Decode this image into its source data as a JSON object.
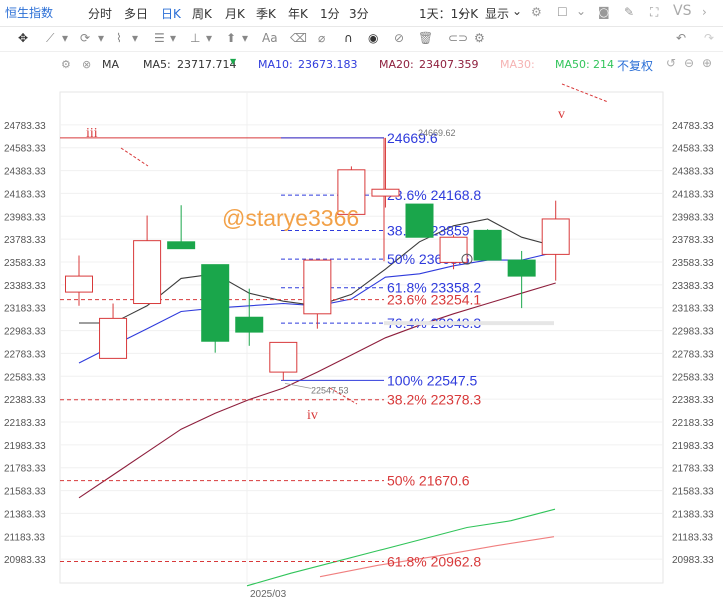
{
  "toolbar": {
    "index_name": "恒生指数",
    "periods": [
      "分时",
      "多日",
      "日K",
      "周K",
      "月K",
      "季K",
      "年K",
      "1分",
      "3分"
    ],
    "active_period": "日K",
    "multi_select": "1天：1分K",
    "display": "显示",
    "vs_label": "VS"
  },
  "ma_bar": {
    "type": "MA",
    "ma5_label": "MA5:",
    "ma5_value": "23717.714",
    "ma10_label": "MA10:",
    "ma10_value": "23673.183",
    "ma20_label": "MA20:",
    "ma20_value": "23407.359",
    "ma30_label": "MA30:",
    "ma50_label": "MA50:",
    "ma50_value": "214",
    "adjust": "不复权"
  },
  "colors": {
    "up": "#d8393a",
    "down": "#1aa64b",
    "ma5": "#3c3c3c",
    "ma10": "#2f3bdc",
    "ma20": "#8e1f3d",
    "ma30": "#f07f7f",
    "ma50": "#31c45a",
    "fib_blue": "#2f3bdc",
    "fib_red": "#d8393a",
    "watermark": "#f2a148"
  },
  "chart_data": {
    "type": "candlestick",
    "x_label_shown": "2025/03",
    "ylim": [
      20783.33,
      24983.33
    ],
    "y_ticks": [
      "24783.33",
      "24583.33",
      "24383.33",
      "24183.33",
      "23983.33",
      "23783.33",
      "23583.33",
      "23383.33",
      "23183.33",
      "22983.33",
      "22783.33",
      "22583.33",
      "22383.33",
      "22183.33",
      "21983.33",
      "21783.33",
      "21583.33",
      "21383.33",
      "21183.33",
      "20983.33"
    ],
    "candles": [
      {
        "open": 23320,
        "close": 23460,
        "high": 23640,
        "low": 23200
      },
      {
        "open": 22740,
        "close": 23090,
        "high": 23220,
        "low": 22740
      },
      {
        "open": 23220,
        "close": 23770,
        "high": 23990,
        "low": 23220
      },
      {
        "open": 23760,
        "close": 23700,
        "high": 24080,
        "low": 23700
      },
      {
        "open": 23560,
        "close": 22890,
        "high": 23560,
        "low": 22790
      },
      {
        "open": 23100,
        "close": 22970,
        "high": 23350,
        "low": 22850
      },
      {
        "open": 22620,
        "close": 22880,
        "high": 22880,
        "low": 22547.53
      },
      {
        "open": 23130,
        "close": 23600,
        "high": 23600,
        "low": 23000
      },
      {
        "open": 24000,
        "close": 24390,
        "high": 24420,
        "low": 24000
      },
      {
        "open": 24160,
        "close": 24220,
        "high": 24669.6,
        "low": 24060
      },
      {
        "open": 24090,
        "close": 23800,
        "high": 24090,
        "low": 23800
      },
      {
        "open": 23580,
        "close": 23800,
        "high": 23820,
        "low": 23520
      },
      {
        "open": 23860,
        "close": 23600,
        "high": 23870,
        "low": 23600
      },
      {
        "open": 23600,
        "close": 23460,
        "high": 23680,
        "low": 23180
      },
      {
        "open": 23650,
        "close": 23960,
        "high": 24120,
        "low": 23420
      }
    ],
    "ma5": [
      23050,
      23050,
      23200,
      23440,
      23480,
      23310,
      23240,
      23200,
      23300,
      23520,
      23760,
      23900,
      23960,
      23800,
      23720
    ],
    "ma10": [
      22700,
      22850,
      23000,
      23150,
      23180,
      23200,
      23220,
      23200,
      23260,
      23450,
      23480,
      23550,
      23600,
      23600,
      23670
    ],
    "ma20": [
      21520,
      21720,
      21920,
      22120,
      22260,
      22380,
      22480,
      22620,
      22770,
      22920,
      23030,
      23130,
      23220,
      23310,
      23400
    ],
    "ma50_tail": [
      20750,
      20860,
      20960,
      21060,
      21160,
      21260,
      21320,
      21420
    ],
    "ma50_red_tail": [
      20830,
      20930,
      21010,
      21100,
      21180
    ],
    "fib_blue": [
      {
        "label": "24669.6",
        "value": 24669.6
      },
      {
        "label": "23.6%  24168.8",
        "value": 24168.8
      },
      {
        "label": "38.2%  23859",
        "value": 23859
      },
      {
        "label": "50%  23608.6",
        "value": 23608.6
      },
      {
        "label": "61.8%  23358.2",
        "value": 23358.2
      },
      {
        "label": "76.4%  23048.3",
        "value": 23048.3
      },
      {
        "label": "100%  22547.5",
        "value": 22547.5
      }
    ],
    "fib_red": [
      {
        "label": "23.6%  23254.1",
        "value": 23254.1
      },
      {
        "label": "38.2%  22378.3",
        "value": 22378.3
      },
      {
        "label": "50%  21670.6",
        "value": 21670.6
      },
      {
        "label": "61.8%  20962.8",
        "value": 20962.8
      }
    ],
    "fib_red_top": 24669.6,
    "high_label": "24669.62",
    "low_label": "22547.53",
    "wave_labels": [
      "iii",
      "iv",
      "v"
    ],
    "watermark": "@starye3366"
  }
}
